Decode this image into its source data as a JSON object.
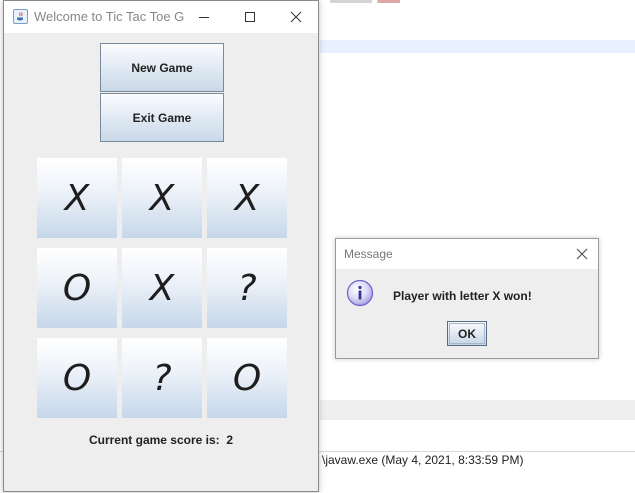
{
  "window": {
    "title": "Welcome to Tic Tac Toe G...",
    "icons": {
      "app": "java-app-icon",
      "minimize": "minimize-icon",
      "maximize": "maximize-icon",
      "close": "close-icon"
    }
  },
  "controls": {
    "new_game_label": "New Game",
    "exit_game_label": "Exit Game"
  },
  "board": {
    "cells": [
      "X",
      "X",
      "X",
      "O",
      "X",
      "?",
      "O",
      "?",
      "O"
    ]
  },
  "score": {
    "label": "Current game score is:",
    "value": "2"
  },
  "dialog": {
    "title": "Message",
    "message": "Player with letter X won!",
    "ok_label": "OK",
    "icon": "info-icon"
  },
  "background": {
    "console_text": "\\javaw.exe  (May 4, 2021, 8:33:59 PM)"
  },
  "colors": {
    "button_gradient_top": "#fbfcfe",
    "button_gradient_bottom": "#c9d8e8",
    "window_bg": "#eeeeee",
    "info_icon": "#6b63c9"
  }
}
